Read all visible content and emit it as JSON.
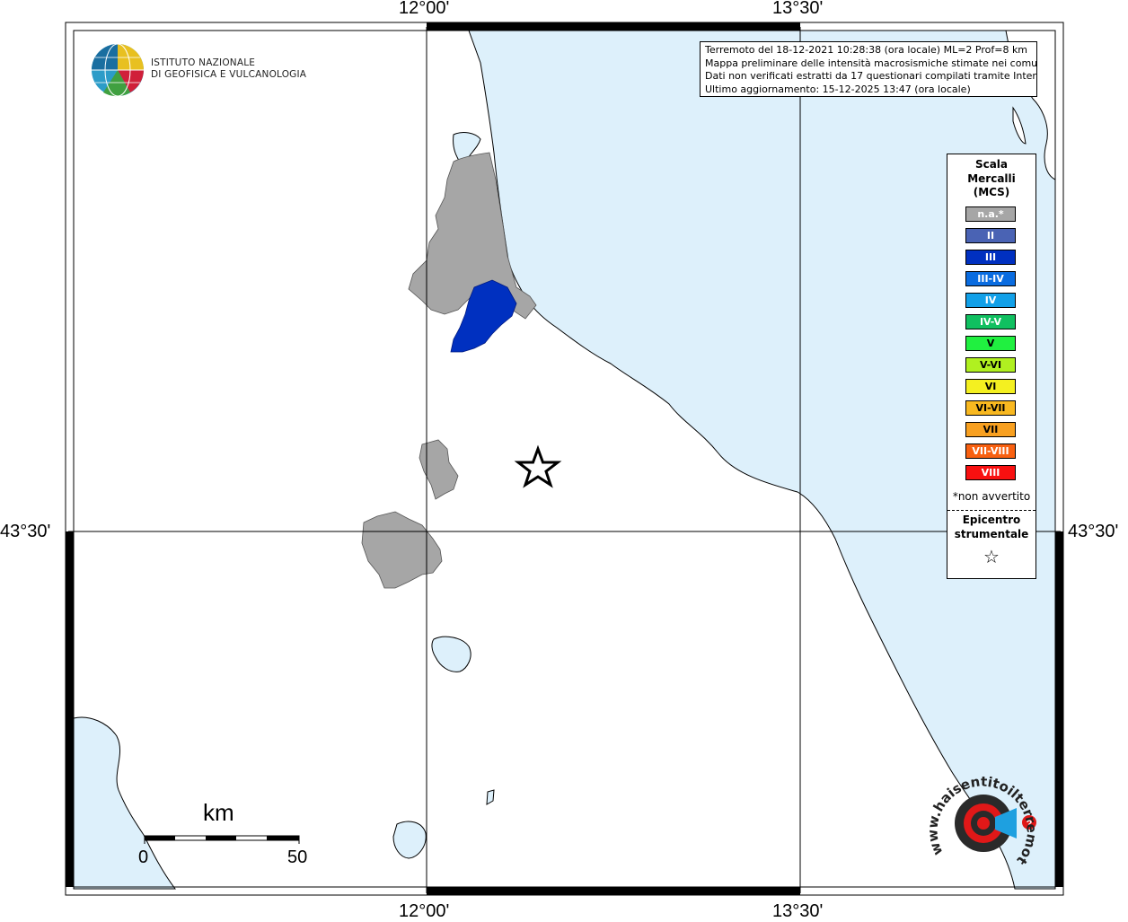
{
  "grid": {
    "top_labels": [
      "12°00'",
      "13°30'"
    ],
    "bottom_labels": [
      "12°00'",
      "13°30'"
    ],
    "left_label": "43°30'",
    "right_label": "43°30'"
  },
  "logo": {
    "line1": "ISTITUTO NAZIONALE",
    "line2": "DI GEOFISICA E VULCANOLOGIA"
  },
  "info": {
    "line1": "Terremoto del 18-12-2021 10:28:38 (ora locale) ML=2 Prof=8 km",
    "line2": "Mappa preliminare delle intensità macrosismiche stimate nei comuni",
    "line3": "Dati non verificati estratti da 17 questionari compilati tramite Internet.",
    "line4": "Ultimo aggiornamento: 15-12-2025 13:47 (ora locale)"
  },
  "legend": {
    "title_line1": "Scala",
    "title_line2": "Mercalli",
    "title_line3": "(MCS)",
    "items": [
      {
        "label": "n.a.*",
        "color": "#a6a6a6"
      },
      {
        "label": "II",
        "color": "#4a63b4"
      },
      {
        "label": "III",
        "color": "#0030c0"
      },
      {
        "label": "III-IV",
        "color": "#0a6ce0"
      },
      {
        "label": "IV",
        "color": "#12a0e8"
      },
      {
        "label": "IV-V",
        "color": "#10c060"
      },
      {
        "label": "V",
        "color": "#20f040"
      },
      {
        "label": "V-VI",
        "color": "#b0f020"
      },
      {
        "label": "VI",
        "color": "#f4f020"
      },
      {
        "label": "VI-VII",
        "color": "#f8b820"
      },
      {
        "label": "VII",
        "color": "#f8a020"
      },
      {
        "label": "VII-VIII",
        "color": "#f86010"
      },
      {
        "label": "VIII",
        "color": "#f81010"
      }
    ],
    "note": "*non avvertito",
    "epicenter_line1": "Epicentro",
    "epicenter_line2": "strumentale",
    "star": "☆"
  },
  "scalebar": {
    "unit": "km",
    "min": "0",
    "max": "50"
  },
  "watermark": {
    "text": "www.haisentitoilterremoto.it"
  },
  "colors": {
    "sea": "#ddf0fb",
    "reported_na": "#a6a6a6",
    "reported_iii": "#0030c0"
  }
}
